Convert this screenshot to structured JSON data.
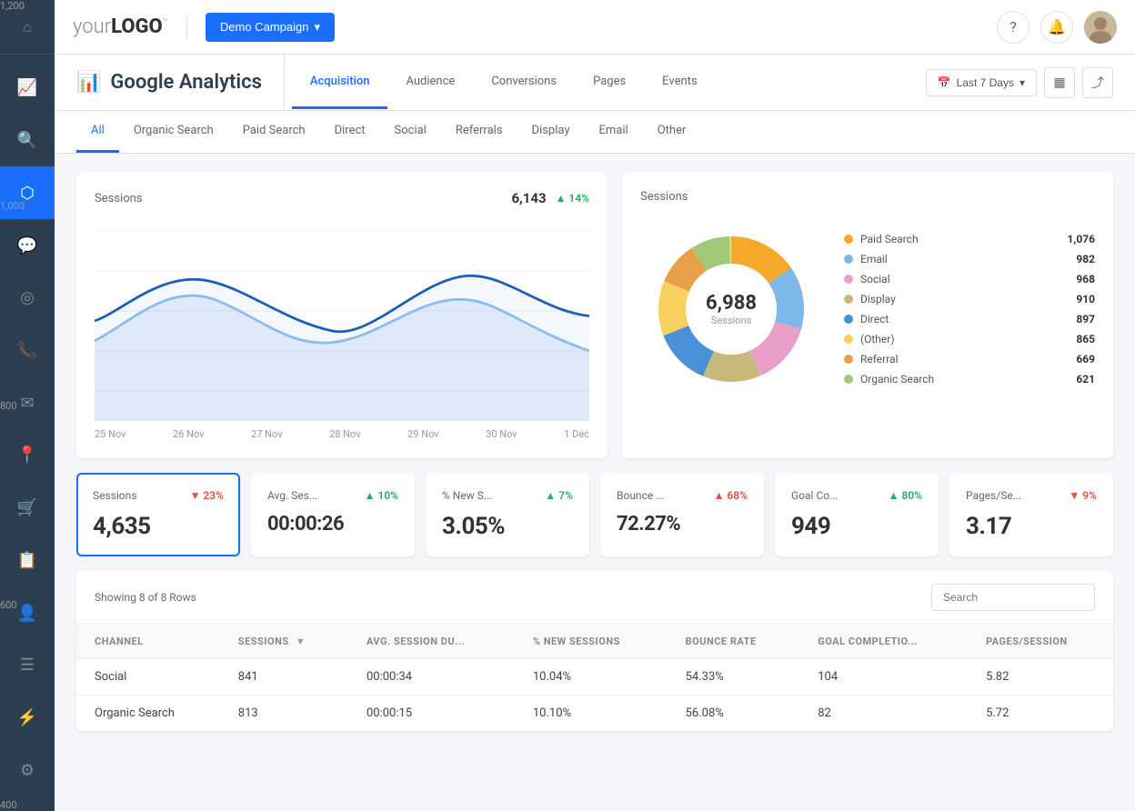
{
  "topbar": {
    "logo_your": "your",
    "logo_logo": "LOGO",
    "logo_tm": "™",
    "campaign_btn": "Demo Campaign",
    "help_icon": "?",
    "bell_icon": "🔔"
  },
  "analytics_header": {
    "icon": "📊",
    "title": "Google Analytics",
    "tabs": [
      {
        "label": "Acquisition",
        "active": true
      },
      {
        "label": "Audience",
        "active": false
      },
      {
        "label": "Conversions",
        "active": false
      },
      {
        "label": "Pages",
        "active": false
      },
      {
        "label": "Events",
        "active": false
      }
    ],
    "date_btn_icon": "📅",
    "date_btn_label": "Last 7 Days",
    "date_btn_caret": "▾",
    "bar_icon": "≡",
    "share_icon": "⤴"
  },
  "filter_tabs": [
    {
      "label": "All",
      "active": true
    },
    {
      "label": "Organic Search",
      "active": false
    },
    {
      "label": "Paid Search",
      "active": false
    },
    {
      "label": "Direct",
      "active": false
    },
    {
      "label": "Social",
      "active": false
    },
    {
      "label": "Referrals",
      "active": false
    },
    {
      "label": "Display",
      "active": false
    },
    {
      "label": "Email",
      "active": false
    },
    {
      "label": "Other",
      "active": false
    }
  ],
  "line_chart": {
    "title": "Sessions",
    "value": "6,143",
    "trend": "▲ 14%",
    "trend_type": "up",
    "y_labels": [
      "1,200",
      "1,000",
      "800",
      "600",
      "400"
    ],
    "x_labels": [
      "25 Nov",
      "26 Nov",
      "27 Nov",
      "28 Nov",
      "29 Nov",
      "30 Nov",
      "1 Dec"
    ]
  },
  "donut_chart": {
    "title": "Sessions",
    "center_value": "6,988",
    "center_label": "Sessions",
    "legend": [
      {
        "name": "Paid Search",
        "value": "1,076",
        "color": "#f4a92a"
      },
      {
        "name": "Email",
        "value": "982",
        "color": "#7eb8e8"
      },
      {
        "name": "Social",
        "value": "968",
        "color": "#e8a0c8"
      },
      {
        "name": "Display",
        "value": "910",
        "color": "#b8b87e"
      },
      {
        "name": "Direct",
        "value": "897",
        "color": "#4a90d9"
      },
      {
        "name": "(Other)",
        "value": "865",
        "color": "#f7d060"
      },
      {
        "name": "Referral",
        "value": "669",
        "color": "#f4a92a"
      },
      {
        "name": "Organic Search",
        "value": "621",
        "color": "#a0c878"
      }
    ]
  },
  "metrics": [
    {
      "name": "Sessions",
      "value": "4,635",
      "trend": "▼ 23%",
      "trend_type": "down",
      "selected": true
    },
    {
      "name": "Avg. Ses...",
      "value": "00:00:26",
      "trend": "▲ 10%",
      "trend_type": "up",
      "selected": false
    },
    {
      "name": "% New S...",
      "value": "3.05%",
      "trend": "▲ 7%",
      "trend_type": "up",
      "selected": false
    },
    {
      "name": "Bounce ...",
      "value": "72.27%",
      "trend": "▲ 68%",
      "trend_type": "down",
      "selected": false
    },
    {
      "name": "Goal Co...",
      "value": "949",
      "trend": "▲ 80%",
      "trend_type": "up",
      "selected": false
    },
    {
      "name": "Pages/Se...",
      "value": "3.17",
      "trend": "▼ 9%",
      "trend_type": "down",
      "selected": false
    }
  ],
  "table": {
    "showing_text": "Showing 8 of 8 Rows",
    "search_placeholder": "Search",
    "columns": [
      "CHANNEL",
      "SESSIONS",
      "AVG. SESSION DU...",
      "% NEW SESSIONS",
      "BOUNCE RATE",
      "GOAL COMPLETIO...",
      "PAGES/SESSION"
    ],
    "rows": [
      [
        "Social",
        "841",
        "00:00:34",
        "10.04%",
        "54.33%",
        "104",
        "5.82"
      ],
      [
        "Organic Search",
        "813",
        "00:00:15",
        "10.10%",
        "56.08%",
        "82",
        "5.72"
      ]
    ]
  },
  "sidebar": {
    "icons": [
      {
        "name": "home",
        "symbol": "⌂",
        "active": false
      },
      {
        "name": "chart",
        "symbol": "📈",
        "active": false
      },
      {
        "name": "search",
        "symbol": "🔍",
        "active": false
      },
      {
        "name": "activity",
        "symbol": "⬡",
        "active": true
      },
      {
        "name": "chat",
        "symbol": "💬",
        "active": false
      },
      {
        "name": "target",
        "symbol": "◎",
        "active": false
      },
      {
        "name": "phone",
        "symbol": "📞",
        "active": false
      },
      {
        "name": "mail",
        "symbol": "✉",
        "active": false
      },
      {
        "name": "location",
        "symbol": "📍",
        "active": false
      },
      {
        "name": "cart",
        "symbol": "🛒",
        "active": false
      },
      {
        "name": "report",
        "symbol": "📋",
        "active": false
      },
      {
        "name": "users",
        "symbol": "👤",
        "active": false
      },
      {
        "name": "list",
        "symbol": "☰",
        "active": false
      }
    ],
    "bottom_icons": [
      {
        "name": "plugin",
        "symbol": "⚡",
        "active": false
      },
      {
        "name": "settings",
        "symbol": "⚙",
        "active": false
      }
    ]
  }
}
